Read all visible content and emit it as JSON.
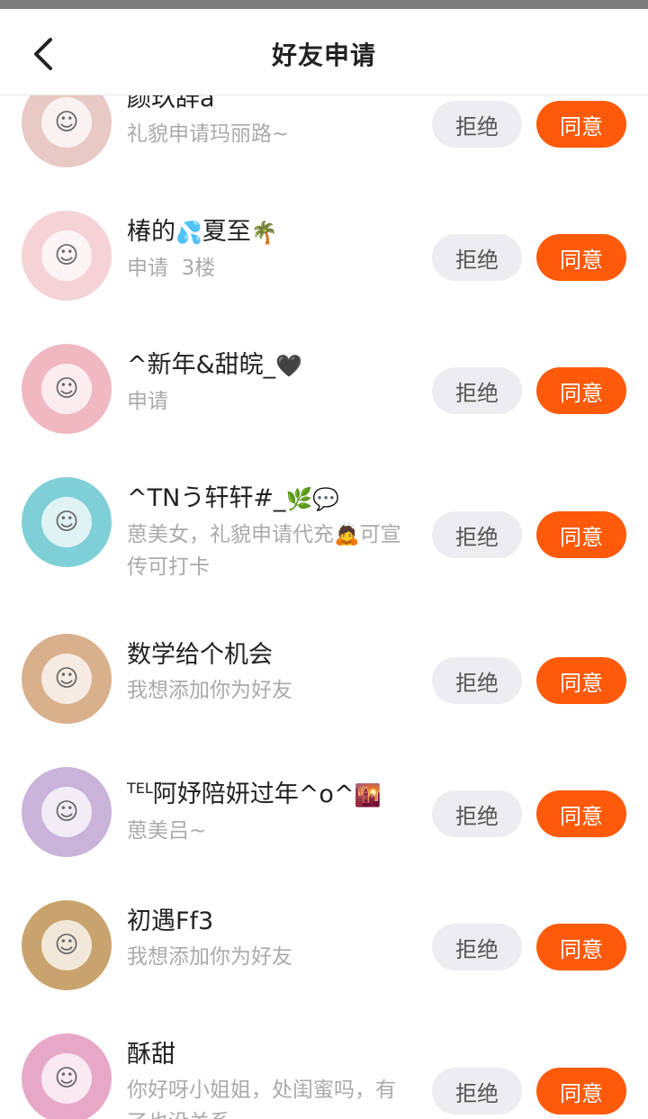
{
  "header": {
    "title": "好友申请"
  },
  "buttons": {
    "reject_label": "拒绝",
    "accept_label": "同意"
  },
  "requests": [
    {
      "name": "颜玖辞a",
      "message": "礼貌申请玛丽路~",
      "avatar_color": "#e8c9c3"
    },
    {
      "name_parts": [
        "椿的",
        "💦",
        "夏至",
        "🌴"
      ],
      "message": "申请  3楼",
      "avatar_color": "#f4d2d6"
    },
    {
      "name_parts": [
        "^新年&甜皖_",
        "🖤"
      ],
      "message": "申请",
      "avatar_color": "#f0b8c0"
    },
    {
      "name_parts": [
        "^TNう轩轩#_",
        "🌿",
        "💬"
      ],
      "message": "葸美女，礼貌申请代充🙇可宣传可打卡",
      "avatar_color": "#7fcfd6"
    },
    {
      "name": "数学给个机会",
      "message": "我想添加你为好友",
      "avatar_color": "#d9b08c"
    },
    {
      "name_parts": [
        "TEL",
        "阿妤陪妍过年^o^",
        "🌇"
      ],
      "message": "葸美吕~",
      "avatar_color": "#c9b3d9"
    },
    {
      "name": "初遇Ff3",
      "message": "我想添加你为好友",
      "avatar_color": "#c9a36d"
    },
    {
      "name": "酥甜",
      "message": "你好呀小姐姐，处闺蜜吗，有了也没关系",
      "avatar_color": "#e7a8c8"
    }
  ]
}
